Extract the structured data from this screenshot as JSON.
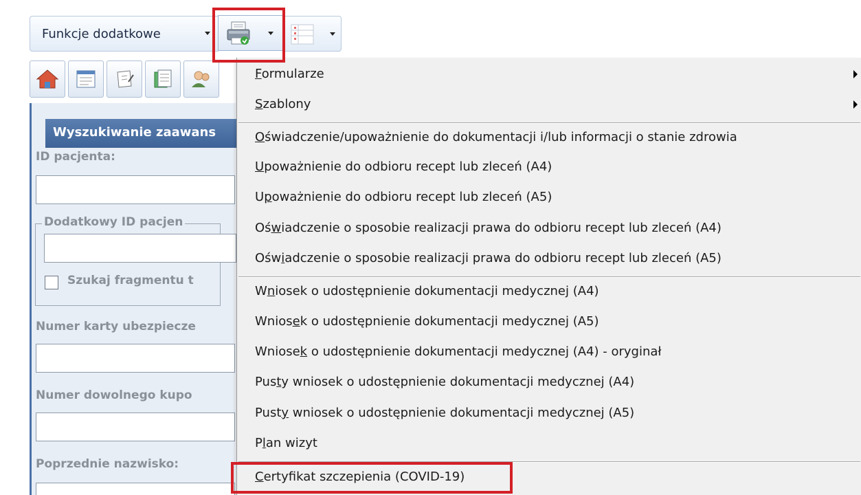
{
  "toolbar": {
    "funkcje_label": "Funkcje dodatkowe"
  },
  "panel": {
    "header": "Wyszukiwanie zaawans",
    "id_pacjenta": "ID pacjenta:",
    "dodatkowy_id": "Dodatkowy ID pacjen",
    "szukaj_fragmentu": "Szukaj fragmentu t",
    "numer_karty": "Numer karty ubezpiecze",
    "numer_kuponu": "Numer dowolnego kupo",
    "poprzednie_nazwisko": "Poprzednie nazwisko:"
  },
  "menu": {
    "items": [
      {
        "pre": "",
        "ul": "F",
        "post": "ormularze",
        "submenu": true
      },
      {
        "pre": "",
        "ul": "S",
        "post": "zablony",
        "submenu": true
      },
      {
        "pre": "",
        "ul": "O",
        "post": "świadczenie/upoważnienie do dokumentacji i/lub informacji o stanie zdrowia"
      },
      {
        "pre": "",
        "ul": "U",
        "post": "poważnienie do odbioru recept lub zleceń (A4)"
      },
      {
        "pre": "U",
        "ul": "p",
        "post": "oważnienie do odbioru recept lub zleceń (A5)"
      },
      {
        "pre": "Oś",
        "ul": "w",
        "post": "iadczenie o sposobie realizacji prawa do odbioru recept lub zleceń (A4)"
      },
      {
        "pre": "Ośw",
        "ul": "i",
        "post": "adczenie o sposobie realizacji prawa do odbioru recept lub zleceń (A5)"
      },
      {
        "pre": "W",
        "ul": "n",
        "post": "iosek o udostępnienie dokumentacji medycznej (A4)"
      },
      {
        "pre": "Wnios",
        "ul": "e",
        "post": "k o udostępnienie dokumentacji medycznej (A5)"
      },
      {
        "pre": "Wniose",
        "ul": "k",
        "post": " o udostępnienie dokumentacji medycznej (A4) - oryginał"
      },
      {
        "pre": "Pus",
        "ul": "t",
        "post": "y wniosek o udostępnienie dokumentacji medycznej (A4)"
      },
      {
        "pre": "Pust",
        "ul": "y",
        "post": " wniosek o udostępnienie dokumentacji medycznej (A5)"
      },
      {
        "pre": "P",
        "ul": "l",
        "post": "an wizyt"
      },
      {
        "pre": "",
        "ul": "C",
        "post": "ertyfikat szczepienia (COVID-19)"
      }
    ]
  },
  "colors": {
    "highlight_border": "#d42027",
    "panel_header": "#4a6fa5",
    "menu_bg": "#f0f0f0"
  }
}
